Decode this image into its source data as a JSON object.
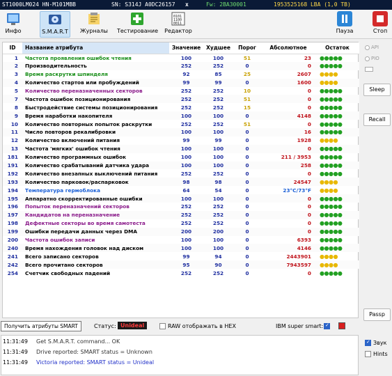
{
  "device": {
    "model": "ST1000LM024 HN-M101MBB",
    "serial": "SN: S314J A0DC26157",
    "close": "x",
    "firmware": "Fw: 2BA30001",
    "capacity": "1953525168 LBA (1,0 TB)"
  },
  "toolbar": {
    "buttons": [
      {
        "label": "Инфо",
        "icon": "info-icon"
      },
      {
        "label": "S.M.A.R.T",
        "icon": "smart-icon"
      },
      {
        "label": "Журналы",
        "icon": "logs-icon"
      },
      {
        "label": "Тестирование",
        "icon": "test-icon"
      },
      {
        "label": "Редактор",
        "icon": "editor-icon"
      }
    ],
    "pause": "Пауза",
    "stop": "Стоп",
    "pause_icon": "pause-icon",
    "stop_icon": "stop-icon"
  },
  "table": {
    "headers": [
      "ID",
      "Название атрибута",
      "Значение",
      "Худшее",
      "Порог",
      "Абсолютное",
      "Остаток"
    ],
    "rows": [
      {
        "id": "1",
        "name": "Частота проявления ошибок чтения",
        "value": "100",
        "worst": "100",
        "threshold": "51",
        "raw": "23",
        "status": "●●●●●",
        "name_color": "#1a8f1a",
        "raw_color": "#c0141c",
        "status_color": "#22a022"
      },
      {
        "id": "2",
        "name": "Производительность",
        "value": "252",
        "worst": "252",
        "threshold": "0",
        "raw": "0",
        "status": "●●●●●",
        "name_color": "#000000",
        "raw_color": "#c0141c",
        "status_color": "#22a022"
      },
      {
        "id": "3",
        "name": "Время раскрутки шпинделя",
        "value": "92",
        "worst": "85",
        "threshold": "25",
        "raw": "2607",
        "status": "●●●●",
        "name_color": "#1a8f1a",
        "raw_color": "#c0141c",
        "status_color": "#e8b800"
      },
      {
        "id": "4",
        "name": "Количество стартов или пробуждений",
        "value": "99",
        "worst": "99",
        "threshold": "0",
        "raw": "1600",
        "status": "●●●●",
        "name_color": "#000000",
        "raw_color": "#c0141c",
        "status_color": "#e8b800"
      },
      {
        "id": "5",
        "name": "Количество переназначенных секторов",
        "value": "252",
        "worst": "252",
        "threshold": "10",
        "raw": "0",
        "status": "●●●●●",
        "name_color": "#8a1a8a",
        "raw_color": "#c0141c",
        "status_color": "#22a022"
      },
      {
        "id": "7",
        "name": "Частота ошибок позиционирования",
        "value": "252",
        "worst": "252",
        "threshold": "51",
        "raw": "0",
        "status": "●●●●●",
        "name_color": "#000000",
        "raw_color": "#c0141c",
        "status_color": "#22a022"
      },
      {
        "id": "8",
        "name": "Быстродействие системы позиционирования",
        "value": "252",
        "worst": "252",
        "threshold": "15",
        "raw": "0",
        "status": "●●●●●",
        "name_color": "#000000",
        "raw_color": "#c0141c",
        "status_color": "#22a022"
      },
      {
        "id": "9",
        "name": "Время наработки накопителя",
        "value": "100",
        "worst": "100",
        "threshold": "0",
        "raw": "4148",
        "status": "●●●●●",
        "name_color": "#000000",
        "raw_color": "#c0141c",
        "status_color": "#22a022"
      },
      {
        "id": "10",
        "name": "Количество повторных попыток раскрутки",
        "value": "252",
        "worst": "252",
        "threshold": "51",
        "raw": "0",
        "status": "●●●●●",
        "name_color": "#000000",
        "raw_color": "#c0141c",
        "status_color": "#22a022"
      },
      {
        "id": "11",
        "name": "Число повторов рекалибровки",
        "value": "100",
        "worst": "100",
        "threshold": "0",
        "raw": "16",
        "status": "●●●●●",
        "name_color": "#000000",
        "raw_color": "#c0141c",
        "status_color": "#22a022"
      },
      {
        "id": "12",
        "name": "Количество включений питания",
        "value": "99",
        "worst": "99",
        "threshold": "0",
        "raw": "1928",
        "status": "●●●●",
        "name_color": "#000000",
        "raw_color": "#c0141c",
        "status_color": "#e8b800"
      },
      {
        "id": "13",
        "name": "Частота 'мягких' ошибок чтения",
        "value": "100",
        "worst": "100",
        "threshold": "0",
        "raw": "0",
        "status": "●●●●●",
        "name_color": "#000000",
        "raw_color": "#c0141c",
        "status_color": "#22a022"
      },
      {
        "id": "181",
        "name": "Количество программных ошибок",
        "value": "100",
        "worst": "100",
        "threshold": "0",
        "raw": "211 / 3953",
        "status": "●●●●●",
        "name_color": "#000000",
        "raw_color": "#c0141c",
        "status_color": "#22a022"
      },
      {
        "id": "191",
        "name": "Количество срабатываний датчика удара",
        "value": "100",
        "worst": "100",
        "threshold": "0",
        "raw": "258",
        "status": "●●●●●",
        "name_color": "#000000",
        "raw_color": "#c0141c",
        "status_color": "#22a022"
      },
      {
        "id": "192",
        "name": "Количество внезапных выключений питания",
        "value": "252",
        "worst": "252",
        "threshold": "0",
        "raw": "0",
        "status": "●●●●●",
        "name_color": "#000000",
        "raw_color": "#c0141c",
        "status_color": "#22a022"
      },
      {
        "id": "193",
        "name": "Количество парковок/распарковок",
        "value": "98",
        "worst": "98",
        "threshold": "0",
        "raw": "24547",
        "status": "●●●●",
        "name_color": "#000000",
        "raw_color": "#c0141c",
        "status_color": "#e8b800"
      },
      {
        "id": "194",
        "name": "Температура гермоблока",
        "value": "64",
        "worst": "54",
        "threshold": "0",
        "raw": "23°C/73°F",
        "status": "●●●●",
        "name_color": "#1a5fd6",
        "raw_color": "#1a5fd6",
        "status_color": "#e8b800"
      },
      {
        "id": "195",
        "name": "Аппаратно скорректированные ошибки",
        "value": "100",
        "worst": "100",
        "threshold": "0",
        "raw": "0",
        "status": "●●●●●",
        "name_color": "#000000",
        "raw_color": "#c0141c",
        "status_color": "#22a022"
      },
      {
        "id": "196",
        "name": "Попыток переназначений секторов",
        "value": "252",
        "worst": "252",
        "threshold": "0",
        "raw": "0",
        "status": "●●●●●",
        "name_color": "#8a1a8a",
        "raw_color": "#c0141c",
        "status_color": "#22a022"
      },
      {
        "id": "197",
        "name": "Кандидатов на переназначение",
        "value": "252",
        "worst": "252",
        "threshold": "0",
        "raw": "0",
        "status": "●●●●●",
        "name_color": "#8a1a8a",
        "raw_color": "#c0141c",
        "status_color": "#22a022"
      },
      {
        "id": "198",
        "name": "Дефектные секторы во время самотеста",
        "value": "252",
        "worst": "252",
        "threshold": "0",
        "raw": "0",
        "status": "●●●●●",
        "name_color": "#8a1a8a",
        "raw_color": "#c0141c",
        "status_color": "#22a022"
      },
      {
        "id": "199",
        "name": "Ошибки передачи данных через DMA",
        "value": "200",
        "worst": "200",
        "threshold": "0",
        "raw": "0",
        "status": "●●●●●",
        "name_color": "#000000",
        "raw_color": "#c0141c",
        "status_color": "#22a022"
      },
      {
        "id": "200",
        "name": "Частота ошибок записи",
        "value": "100",
        "worst": "100",
        "threshold": "0",
        "raw": "6393",
        "status": "●●●●●",
        "name_color": "#8a1a8a",
        "raw_color": "#c0141c",
        "status_color": "#22a022"
      },
      {
        "id": "240",
        "name": "Время нахождения головок над диском",
        "value": "100",
        "worst": "100",
        "threshold": "0",
        "raw": "4146",
        "status": "●●●●●",
        "name_color": "#000000",
        "raw_color": "#c0141c",
        "status_color": "#22a022"
      },
      {
        "id": "241",
        "name": "Всего записано секторов",
        "value": "99",
        "worst": "94",
        "threshold": "0",
        "raw": "2443901",
        "status": "●●●●",
        "name_color": "#000000",
        "raw_color": "#c0141c",
        "status_color": "#e8b800"
      },
      {
        "id": "242",
        "name": "Всего прочитано секторов",
        "value": "95",
        "worst": "90",
        "threshold": "0",
        "raw": "7943597",
        "status": "●●●●",
        "name_color": "#000000",
        "raw_color": "#c0141c",
        "status_color": "#e8b800"
      },
      {
        "id": "254",
        "name": "Счетчик свободных падений",
        "value": "252",
        "worst": "252",
        "threshold": "0",
        "raw": "0",
        "status": "●●●●●",
        "name_color": "#000000",
        "raw_color": "#c0141c",
        "status_color": "#22a022"
      }
    ]
  },
  "side": {
    "api": "API",
    "pio": "PIO",
    "sleep": "Sleep",
    "recall": "Recall",
    "passp": "Passp"
  },
  "status_bar": {
    "get_button": "Получить атрибуты SMART",
    "status_label": "Статус:",
    "status_value": "Unideal",
    "raw_hex": "RAW отображать в HEX",
    "ibm": "IBM super smart:"
  },
  "log": [
    {
      "time": "11:31:49",
      "text": "Get S.M.A.R.T. command... OK",
      "color": "#333333"
    },
    {
      "time": "11:31:49",
      "text": "Drive reported: SMART status = Unknown",
      "color": "#333333"
    },
    {
      "time": "11:31:49",
      "text": "Victoria reported: SMART status = Unideal",
      "color": "#1f2fc8"
    }
  ],
  "bottom_right": {
    "sound": "Звук",
    "hints": "Hints"
  }
}
